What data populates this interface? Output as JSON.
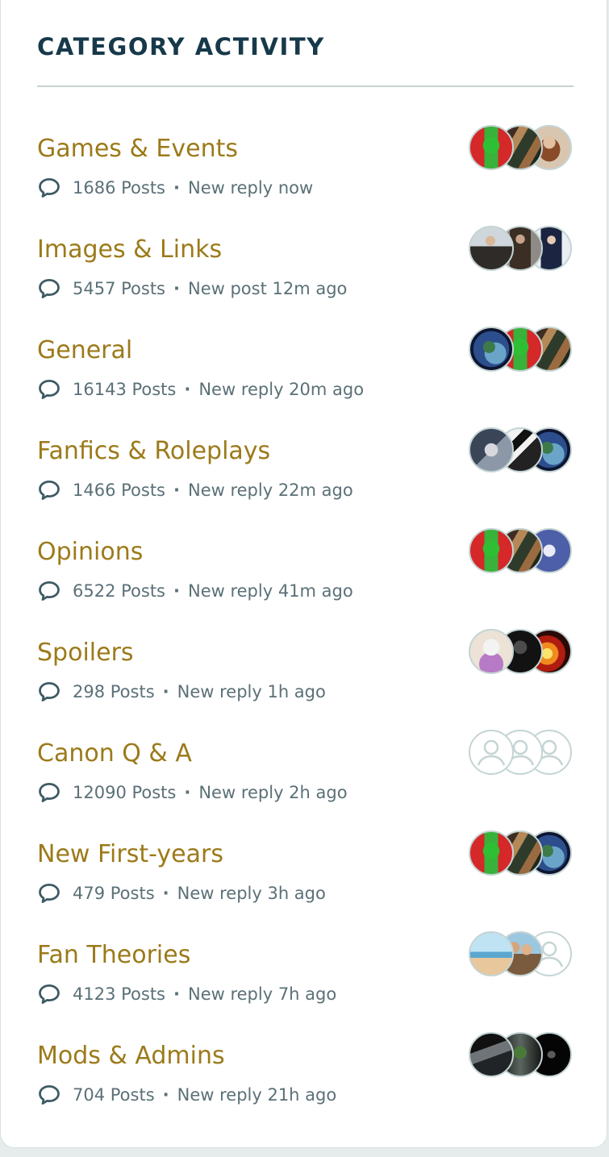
{
  "heading": "CATEGORY ACTIVITY",
  "categories": [
    {
      "name": "Games & Events",
      "posts": "1686 Posts",
      "activity": "New reply now",
      "avatars": [
        "img-green",
        "img-brown",
        "img-portrait"
      ]
    },
    {
      "name": "Images & Links",
      "posts": "5457 Posts",
      "activity": "New post 12m ago",
      "avatars": [
        "img-man",
        "img-coat",
        "img-dark-figure"
      ]
    },
    {
      "name": "General",
      "posts": "16143 Posts",
      "activity": "New reply 20m ago",
      "avatars": [
        "img-earth",
        "img-green",
        "img-brown"
      ]
    },
    {
      "name": "Fanfics & Roleplays",
      "posts": "1466 Posts",
      "activity": "New reply 22m ago",
      "avatars": [
        "img-anime",
        "img-mono",
        "img-earth"
      ]
    },
    {
      "name": "Opinions",
      "posts": "6522 Posts",
      "activity": "New reply 41m ago",
      "avatars": [
        "img-green",
        "img-brown",
        "img-knew"
      ]
    },
    {
      "name": "Spoilers",
      "posts": "298 Posts",
      "activity": "New reply 1h ago",
      "avatars": [
        "img-cartoon",
        "img-dark",
        "img-fire"
      ]
    },
    {
      "name": "Canon Q & A",
      "posts": "12090 Posts",
      "activity": "New reply 2h ago",
      "avatars": [
        "placeholder",
        "placeholder",
        "placeholder"
      ]
    },
    {
      "name": "New First-years",
      "posts": "479 Posts",
      "activity": "New reply 3h ago",
      "avatars": [
        "img-green",
        "img-brown",
        "img-earth"
      ]
    },
    {
      "name": "Fan Theories",
      "posts": "4123 Posts",
      "activity": "New reply 7h ago",
      "avatars": [
        "img-beach",
        "img-couple",
        "placeholder"
      ]
    },
    {
      "name": "Mods & Admins",
      "posts": "704 Posts",
      "activity": "New reply 21h ago",
      "avatars": [
        "img-mod1",
        "img-mod2",
        "img-mod3"
      ]
    }
  ],
  "icons": {
    "meta": "comment-bubble-icon",
    "placeholder_avatar": "user-placeholder-icon"
  },
  "colors": {
    "heading": "#17394a",
    "category_name": "#9c7a1a",
    "meta_text": "#5b7077",
    "divider": "#c6d3d3"
  }
}
